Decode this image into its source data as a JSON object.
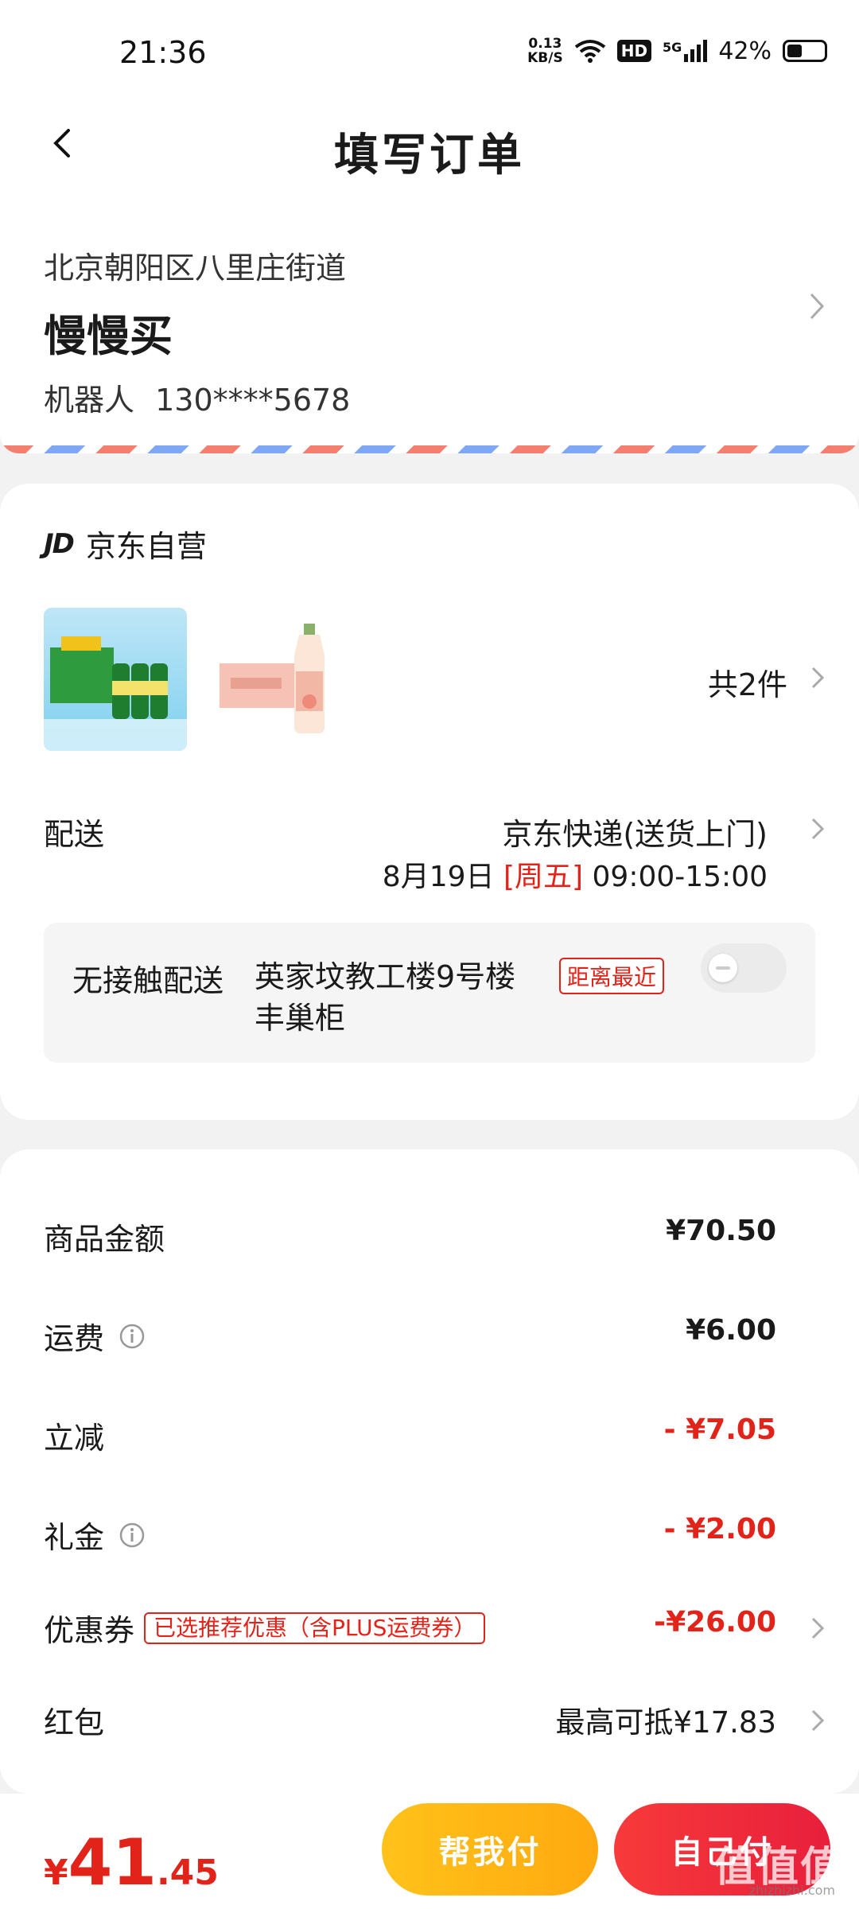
{
  "status_bar": {
    "time": "21:36",
    "net_speed_value": "0.13",
    "net_speed_unit": "KB/S",
    "hd": "HD",
    "signal": "5G",
    "battery": "42%",
    "battery_level": 0.42
  },
  "nav": {
    "title": "填写订单"
  },
  "address": {
    "region": "北京朝阳区八里庄街道",
    "name": "慢慢买",
    "recipient": "机器人",
    "phone": "130****5678"
  },
  "shop": {
    "logo": "JD",
    "name": "京东自营",
    "items_count": "共2件",
    "shipping_label": "配送",
    "shipping_method": "京东快递(送货上门)",
    "shipping_date": "8月19日",
    "shipping_weekday": "[周五]",
    "shipping_window": "09:00-15:00",
    "contactless": {
      "label": "无接触配送",
      "locker": "英家坟教工楼9号楼丰巢柜",
      "tag": "距离最近",
      "enabled": false
    }
  },
  "prices": {
    "goods_label": "商品金额",
    "goods_value": "¥70.50",
    "freight_label": "运费",
    "freight_value": "¥6.00",
    "instant_label": "立减",
    "instant_value": "- ¥7.05",
    "gift_label": "礼金",
    "gift_value": "- ¥2.00",
    "coupon_label": "优惠券",
    "coupon_tag": "已选推荐优惠（含PLUS运费券）",
    "coupon_value": "-¥26.00",
    "redpack_label": "红包",
    "redpack_value": "最高可抵¥17.83"
  },
  "footer": {
    "currency": "¥",
    "total_int": "41",
    "total_dec": ".45",
    "help_pay": "帮我付",
    "self_pay": "自己付",
    "watermark": "值值值",
    "watermark_sub": "zhizhizhi.com"
  },
  "colors": {
    "accent_red": "#e2231a",
    "help_btn": "#ffb612",
    "self_btn": "#f0283a"
  }
}
